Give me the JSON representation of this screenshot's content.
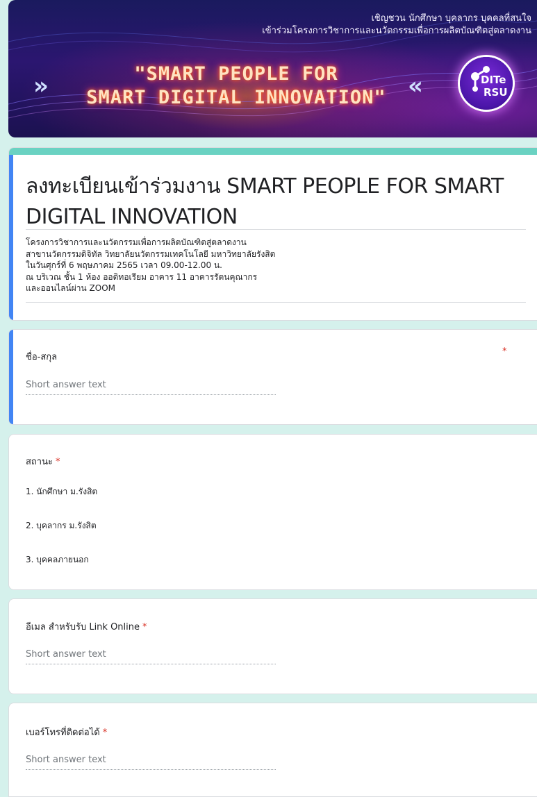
{
  "banner": {
    "invite_line1": "เชิญชวน นักศึกษา บุคลากร บุคคลที่สนใจ",
    "invite_line2": "เข้าร่วมโครงการวิชาการและนวัตกรรมเพื่อการผลิตบัณฑิตสู่ตลาดงาน",
    "headline_line1": "\"SMART PEOPLE FOR",
    "headline_line2": "SMART DIGITAL INNOVATION\"",
    "chevron_left": "»",
    "chevron_right": "«",
    "logo_text_1": "DITe",
    "logo_text_2": "RSU"
  },
  "form": {
    "title": "ลงทะเบียนเข้าร่วมงาน SMART PEOPLE FOR SMART DIGITAL INNOVATION",
    "description": [
      "โครงการวิชาการและนวัตกรรมเพื่อการผลิตบัณฑิตสู่ตลาดงาน",
      "สาขานวัตกรรมดิจิทัล วิทยาลัยนวัตกรรมเทคโนโลยี มหาวิทยาลัยรังสิต",
      "ในวันศุกร์ที่ 6 พฤษภาคม 2565 เวลา 09.00-12.00 น.",
      "ณ บริเวณ ชั้น 1 ห้อง ออดิทอเรียม อาคาร 11  อาคารรัตนคุณากร",
      "และออนไลน์ผ่าน ZOOM"
    ]
  },
  "questions": {
    "q1": {
      "label": "ชื่อ-สกุล",
      "required_mark": "*",
      "placeholder": "Short answer text"
    },
    "q2": {
      "label": "สถานะ",
      "required_mark": "*",
      "options": [
        "1.  นักศึกษา ม.รังสิต",
        "2.  บุคลากร ม.รังสิต",
        "3.  บุคคลภายนอก"
      ]
    },
    "q3": {
      "label": "อีเมล สำหรับรับ Link Online",
      "required_mark": "*",
      "placeholder": "Short answer text"
    },
    "q4": {
      "label": "เบอร์โทรที่ติดต่อได้",
      "required_mark": "*",
      "placeholder": "Short answer text"
    }
  },
  "colors": {
    "background": "#d5f1ec",
    "theme_bar": "#6ad2c2",
    "active_bar": "#4285f4",
    "required": "#d93025"
  }
}
